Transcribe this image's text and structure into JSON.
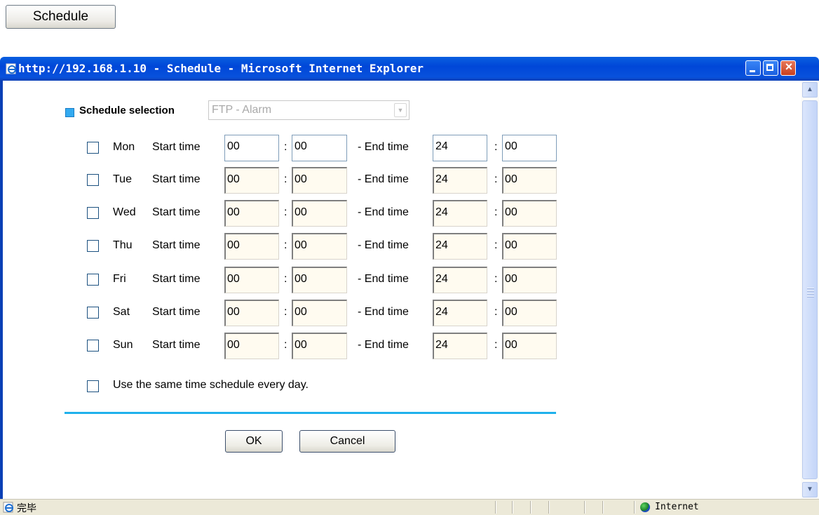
{
  "schedule_button_label": "Schedule",
  "window": {
    "title": "http://192.168.1.10 - Schedule - Microsoft Internet Explorer"
  },
  "form": {
    "selection_label": "Schedule selection",
    "selection_value": "FTP - Alarm",
    "start_label": "Start time",
    "end_label": "- End time",
    "colon": ":",
    "days": [
      {
        "name": "Mon",
        "start_h": "00",
        "start_m": "00",
        "end_h": "24",
        "end_m": "00"
      },
      {
        "name": "Tue",
        "start_h": "00",
        "start_m": "00",
        "end_h": "24",
        "end_m": "00"
      },
      {
        "name": "Wed",
        "start_h": "00",
        "start_m": "00",
        "end_h": "24",
        "end_m": "00"
      },
      {
        "name": "Thu",
        "start_h": "00",
        "start_m": "00",
        "end_h": "24",
        "end_m": "00"
      },
      {
        "name": "Fri",
        "start_h": "00",
        "start_m": "00",
        "end_h": "24",
        "end_m": "00"
      },
      {
        "name": "Sat",
        "start_h": "00",
        "start_m": "00",
        "end_h": "24",
        "end_m": "00"
      },
      {
        "name": "Sun",
        "start_h": "00",
        "start_m": "00",
        "end_h": "24",
        "end_m": "00"
      }
    ],
    "same_schedule_label": "Use the same time schedule every day.",
    "ok_label": "OK",
    "cancel_label": "Cancel"
  },
  "statusbar": {
    "status_text": "完毕",
    "zone_text": "Internet"
  },
  "colors": {
    "titlebar": "#0a5fe0",
    "divider": "#1fb1ec",
    "selection_marker": "#33aaf0"
  },
  "icons": [
    "ie-page-icon",
    "minimize-icon",
    "maximize-icon",
    "close-icon",
    "scroll-up-icon",
    "scroll-down-icon",
    "internet-zone-icon"
  ]
}
